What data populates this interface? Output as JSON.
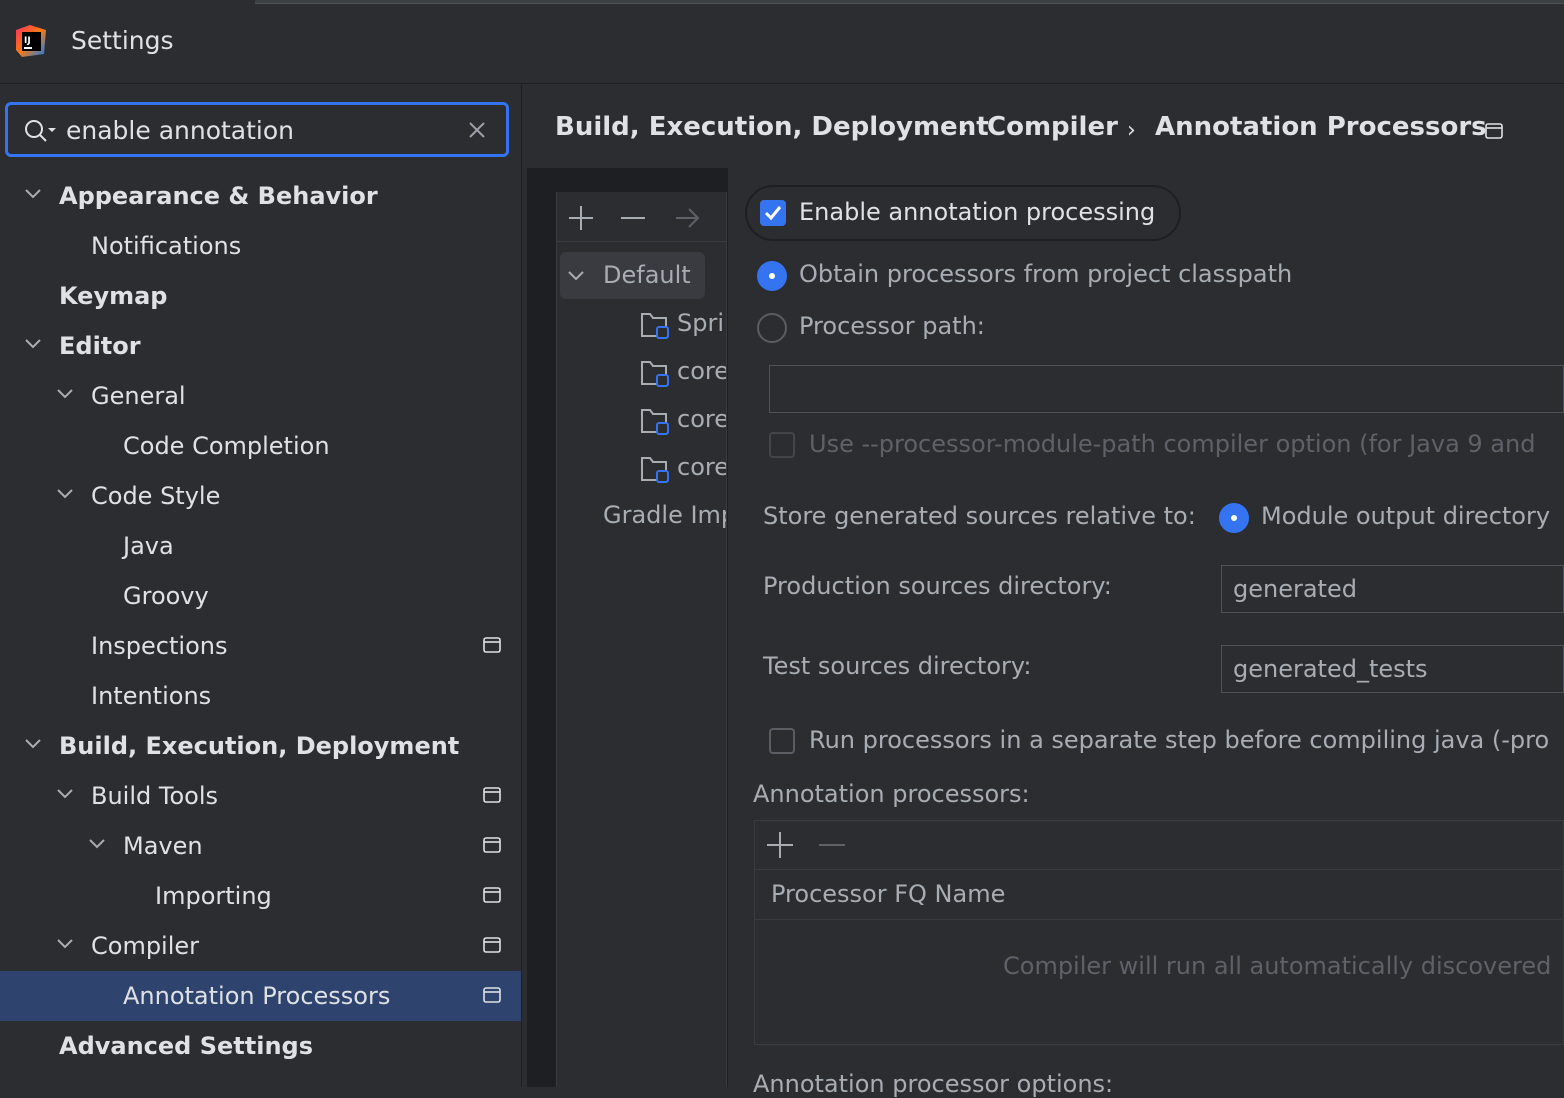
{
  "window": {
    "title": "Settings"
  },
  "search": {
    "value": "enable annotation",
    "placeholder": ""
  },
  "tree": {
    "appearance": "Appearance & Behavior",
    "notifications": "Notifications",
    "keymap": "Keymap",
    "editor": "Editor",
    "general": "General",
    "code_completion": "Code Completion",
    "code_style": "Code Style",
    "java": "Java",
    "groovy": "Groovy",
    "inspections": "Inspections",
    "intentions": "Intentions",
    "build": "Build, Execution, Deployment",
    "build_tools": "Build Tools",
    "maven": "Maven",
    "importing": "Importing",
    "compiler": "Compiler",
    "annotation_processors": "Annotation Processors",
    "advanced": "Advanced Settings"
  },
  "breadcrumb": {
    "items": [
      "Build, Execution, Deployment",
      "Compiler",
      "Annotation Processors"
    ],
    "separator": "›"
  },
  "profiles": {
    "default": "Default",
    "modules": [
      "Spri",
      "core",
      "core",
      "core"
    ],
    "gradle": "Gradle Imp"
  },
  "settings": {
    "enable_label": "Enable annotation processing",
    "enable_checked": true,
    "obtain_label": "Obtain processors from project classpath",
    "processor_path_label": "Processor path:",
    "processor_path_value": "",
    "module_path_label": "Use --processor-module-path compiler option (for Java 9 and",
    "store_label": "Store generated sources relative to:",
    "module_output_label": "Module output directory",
    "production_label": "Production sources directory:",
    "production_value": "generated",
    "test_label": "Test sources directory:",
    "test_value": "generated_tests",
    "run_separate_label": "Run processors in a separate step before compiling java (-pro",
    "annotation_processors_label": "Annotation processors:",
    "fq_name_header": "Processor FQ Name",
    "empty_text": "Compiler will run all automatically discovered",
    "options_label": "Annotation processor options:"
  },
  "colors": {
    "accent": "#3574f0",
    "selection": "#2e436e",
    "background": "#2b2d30"
  }
}
